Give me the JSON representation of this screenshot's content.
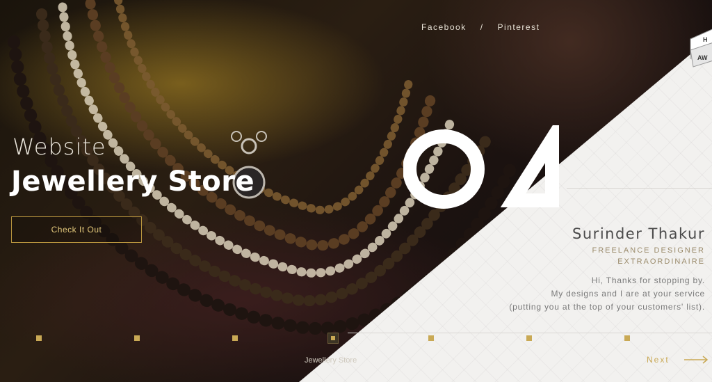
{
  "nav": {
    "facebook": "Facebook",
    "separator": "/",
    "pinterest": "Pinterest"
  },
  "slide": {
    "number": "04",
    "subtitle": "Website",
    "title": "Jewellery Store",
    "cta_label": "Check It Out",
    "caption": "Jewellery Store"
  },
  "designer": {
    "name": "Surinder Thakur",
    "role_line1": "FREELANCE DESIGNER",
    "role_line2": "EXTRAORDINAIRE",
    "greeting_line1": "Hi, Thanks for stopping by.",
    "greeting_line2": "My designs and I are at your service",
    "greeting_line3": "(putting you at the top of your customers' list)."
  },
  "pager": {
    "count": 7,
    "active_index": 3,
    "next_label": "Next"
  },
  "award": {
    "line1": "H",
    "line2": "AW"
  },
  "colors": {
    "accent": "#c9a955",
    "panel": "#f2f1ef",
    "dark": "#1a140c"
  }
}
